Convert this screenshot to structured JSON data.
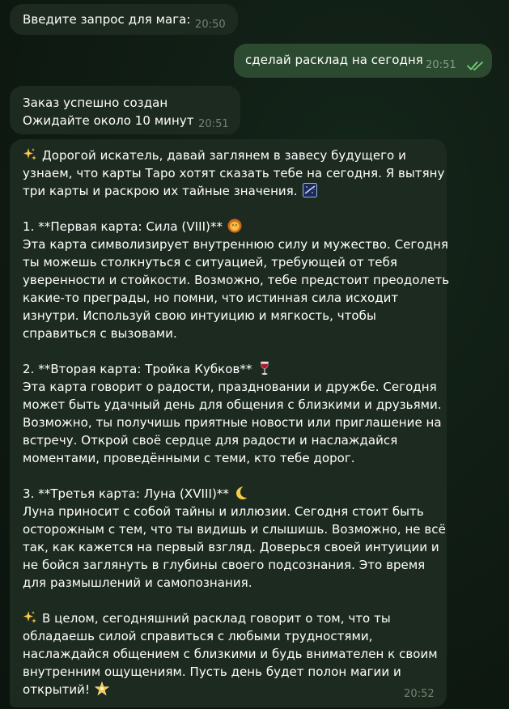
{
  "messages": [
    {
      "id": "m1",
      "direction": "incoming",
      "lines": [
        "Введите запрос для мага:"
      ],
      "time": "20:50"
    },
    {
      "id": "m2",
      "direction": "outgoing",
      "lines": [
        "сделай расклад на сегодня"
      ],
      "time": "20:51",
      "status_icon": "double-check-icon"
    },
    {
      "id": "m3",
      "direction": "incoming",
      "lines": [
        "Заказ успешно создан",
        "Ожидайте около 10 минут"
      ],
      "time": "20:51"
    },
    {
      "id": "m4",
      "direction": "incoming",
      "time": "20:52",
      "lines": [
        "Дорогой искатель, давай заглянем в завесу будущего и",
        "узнаем, что карты Таро хотят сказать тебе на сегодня. Я вытяну",
        "три карты и раскрою их тайные значения.",
        "",
        "1. **Первая карта: Сила (VIII)**",
        "Эта карта символизирует внутреннюю силу и мужество. Сегодня",
        "ты можешь столкнуться с ситуацией, требующей от тебя",
        "уверенности и стойкости. Возможно, тебе предстоит преодолеть",
        "какие-то преграды, но помни, что истинная сила исходит",
        "изнутри. Используй свою интуицию и мягкость, чтобы",
        "справиться с вызовами.",
        "",
        "2. **Вторая карта: Тройка Кубков**",
        "Эта карта говорит о радости, праздновании и дружбе. Сегодня",
        "может быть удачный день для общения с близкими и друзьями.",
        "Возможно, ты получишь приятные новости или приглашение на",
        "встречу. Открой своё сердце для радости и наслаждайся",
        "моментами, проведёнными с теми, кто тебе дорог.",
        "",
        "3. **Третья карта: Луна (XVIII)**",
        "Луна приносит с собой тайны и иллюзии. Сегодня стоит быть",
        "осторожным с тем, что ты видишь и слышишь. Возможно, не всё",
        "так, как кажется на первый взгляд. Доверься своей интуиции и",
        "не бойся заглянуть в глубины своего подсознания. Это время",
        "для размышлений и самопознания.",
        "",
        "В целом, сегодняшний расклад говорит о том, что ты",
        "обладаешь силой справиться с любыми трудностями,",
        "наслаждайся общением с близкими и будь внимателен к своим",
        "внутренним ощущениям. Пусть день будет полон магии и",
        "открытий!"
      ],
      "icons": {
        "sparkles": "sparkles-icon",
        "galaxy": "galaxy-icon",
        "lion": "lion-face-icon",
        "wine": "wine-glass-icon",
        "moon": "crescent-moon-icon",
        "star": "glowing-star-icon"
      }
    }
  ],
  "colors": {
    "background": "#0f1a12",
    "incoming_bubble": "#1d2a1f",
    "outgoing_bubble": "#2c4a2f",
    "timestamp": "#6f8572",
    "read_check": "#6fd17a"
  }
}
